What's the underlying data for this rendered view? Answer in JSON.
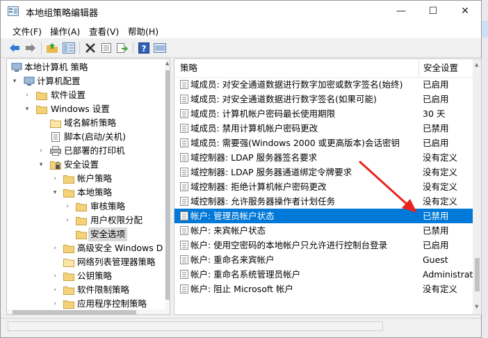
{
  "window": {
    "title": "本地组策略编辑器",
    "minimize_glyph": "—",
    "maximize_glyph": "☐",
    "close_glyph": "✕"
  },
  "menu": [
    "文件(F)",
    "操作(A)",
    "查看(V)",
    "帮助(H)"
  ],
  "toolbar_icons": [
    "back-icon",
    "forward-icon",
    "up-folder-icon",
    "show-tree-icon",
    "delete-icon",
    "properties-icon",
    "export-icon",
    "help-icon",
    "console-icon"
  ],
  "tree": [
    {
      "label": "本地计算机 策略",
      "arrow": "",
      "icon": "computer"
    },
    {
      "label": "计算机配置",
      "arrow": "▾",
      "icon": "computer"
    },
    {
      "label": "软件设置",
      "arrow": "›",
      "icon": "folder"
    },
    {
      "label": "Windows 设置",
      "arrow": "▾",
      "icon": "folder"
    },
    {
      "label": "域名解析策略",
      "arrow": "",
      "icon": "folder"
    },
    {
      "label": "脚本(启动/关机)",
      "arrow": "",
      "icon": "script"
    },
    {
      "label": "已部署的打印机",
      "arrow": "›",
      "icon": "printer"
    },
    {
      "label": "安全设置",
      "arrow": "▾",
      "icon": "shield"
    },
    {
      "label": "帐户策略",
      "arrow": "›",
      "icon": "folder"
    },
    {
      "label": "本地策略",
      "arrow": "▾",
      "icon": "folder"
    },
    {
      "label": "审核策略",
      "arrow": "›",
      "icon": "folder"
    },
    {
      "label": "用户权限分配",
      "arrow": "›",
      "icon": "folder"
    },
    {
      "label": "安全选项",
      "arrow": "",
      "icon": "folder",
      "selected": true
    },
    {
      "label": "高级安全 Windows D",
      "arrow": "›",
      "icon": "folder"
    },
    {
      "label": "网络列表管理器策略",
      "arrow": "",
      "icon": "folder"
    },
    {
      "label": "公钥策略",
      "arrow": "›",
      "icon": "folder"
    },
    {
      "label": "软件限制策略",
      "arrow": "›",
      "icon": "folder"
    },
    {
      "label": "应用程序控制策略",
      "arrow": "›",
      "icon": "folder"
    }
  ],
  "policy_header": {
    "col_policy": "策略",
    "col_setting": "安全设置"
  },
  "policies": [
    {
      "name": "域成员: 对安全通道数据进行数字加密或数字签名(始终)",
      "value": "已启用"
    },
    {
      "name": "域成员: 对安全通道数据进行数字签名(如果可能)",
      "value": "已启用"
    },
    {
      "name": "域成员: 计算机帐户密码最长使用期限",
      "value": "30 天"
    },
    {
      "name": "域成员: 禁用计算机帐户密码更改",
      "value": "已禁用"
    },
    {
      "name": "域成员: 需要强(Windows 2000 或更高版本)会话密钥",
      "value": "已启用"
    },
    {
      "name": "域控制器: LDAP 服务器签名要求",
      "value": "没有定义"
    },
    {
      "name": "域控制器: LDAP 服务器通道绑定令牌要求",
      "value": "没有定义"
    },
    {
      "name": "域控制器: 拒绝计算机帐户密码更改",
      "value": "没有定义"
    },
    {
      "name": "域控制器: 允许服务器操作者计划任务",
      "value": "没有定义"
    },
    {
      "name": "帐户: 管理员帐户状态",
      "value": "已禁用",
      "selected": true
    },
    {
      "name": "帐户: 来宾帐户状态",
      "value": "已禁用"
    },
    {
      "name": "帐户: 使用空密码的本地帐户只允许进行控制台登录",
      "value": "已启用"
    },
    {
      "name": "帐户: 重命名来宾帐户",
      "value": "Guest"
    },
    {
      "name": "帐户: 重命名系统管理员帐户",
      "value": "Administrat"
    },
    {
      "name": "帐户: 阻止 Microsoft 帐户",
      "value": "没有定义"
    }
  ],
  "colors": {
    "selection": "#0078d7",
    "annotation_arrow": "#e8231e"
  }
}
